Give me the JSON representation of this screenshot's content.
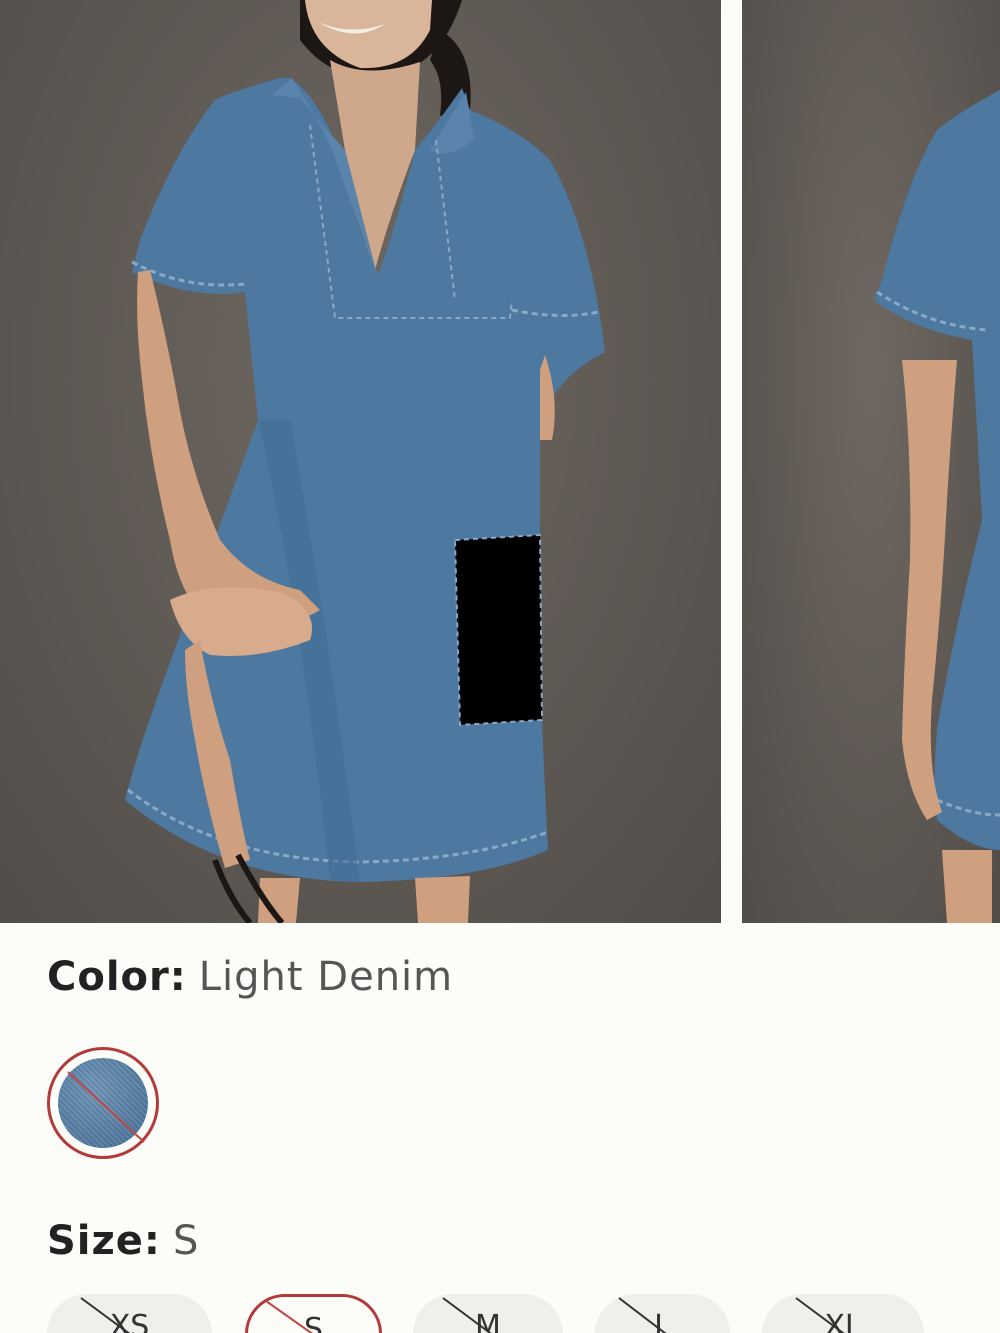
{
  "product": {
    "color": {
      "label": "Color:",
      "value": "Light Denim"
    },
    "swatches": [
      {
        "name": "Light Denim",
        "selected": true,
        "unavailable": true,
        "color": "#547ca2"
      }
    ],
    "size": {
      "label": "Size:",
      "value": "S"
    },
    "sizes": [
      {
        "label": "XS",
        "unavailable": true,
        "selected": false
      },
      {
        "label": "S",
        "unavailable": true,
        "selected": true
      },
      {
        "label": "M",
        "unavailable": true,
        "selected": false
      },
      {
        "label": "L",
        "unavailable": true,
        "selected": false
      },
      {
        "label": "XL",
        "unavailable": true,
        "selected": false
      }
    ]
  },
  "colors": {
    "accent_selected": "#b23a3a",
    "photo_background": "#5f5954",
    "denim": "#4f7aa3",
    "page_background": "#fcfcf8"
  }
}
